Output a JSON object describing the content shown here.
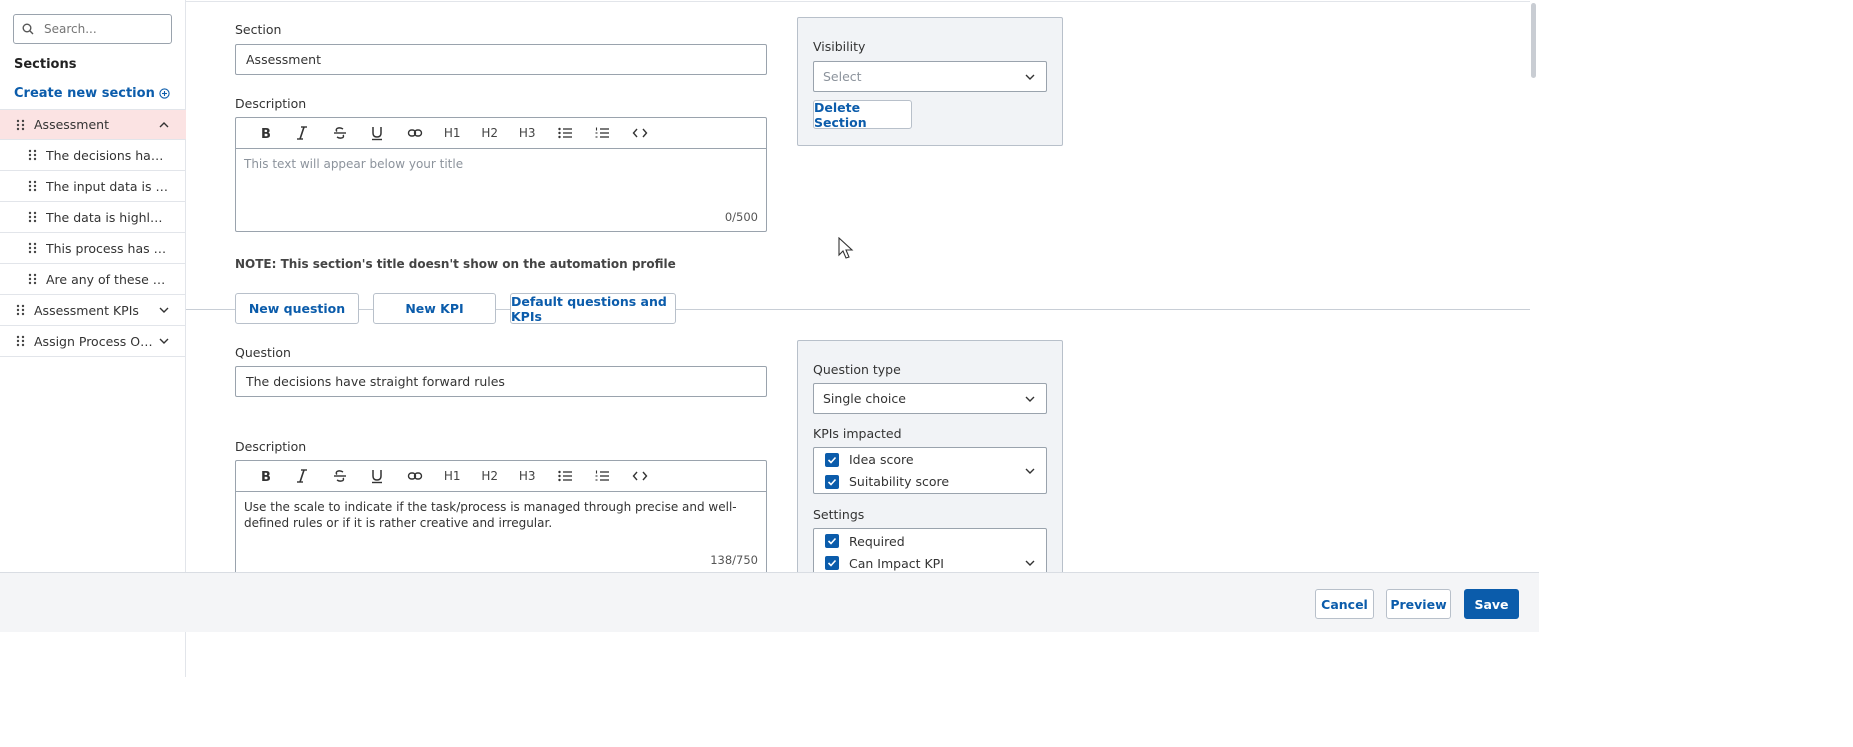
{
  "sidebar": {
    "search_placeholder": "Search...",
    "heading": "Sections",
    "create_label": "Create new section",
    "items": [
      {
        "label": "Assessment",
        "level": "top",
        "active": true,
        "expanded": true
      },
      {
        "label": "The decisions have straight forward rules",
        "level": "child"
      },
      {
        "label": "The input data is accessible",
        "level": "child"
      },
      {
        "label": "The data is highly formatted",
        "level": "child"
      },
      {
        "label": "This process has no expected changes",
        "level": "child"
      },
      {
        "label": "Are any of these processes",
        "level": "child"
      },
      {
        "label": "Assessment KPIs",
        "level": "top",
        "expanded": false
      },
      {
        "label": "Assign Process Owner",
        "level": "top",
        "expanded": false
      }
    ]
  },
  "section": {
    "label": "Section",
    "value": "Assessment",
    "description_label": "Description",
    "description_placeholder": "This text will appear below your title",
    "counter": "0/500",
    "note": "NOTE: This section's title doesn't show on the automation profile"
  },
  "toolbar": {
    "h1": "H1",
    "h2": "H2",
    "h3": "H3"
  },
  "visibility_panel": {
    "label": "Visibility",
    "select_placeholder": "Select",
    "delete_label": "Delete Section"
  },
  "actions": {
    "new_question": "New question",
    "new_kpi": "New KPI",
    "defaults": "Default questions and KPIs"
  },
  "question": {
    "label": "Question",
    "value": "The decisions have straight forward rules",
    "description_label": "Description",
    "description_text": "Use the scale to indicate if the task/process is managed through precise and well-defined rules or if it is rather creative and irregular.",
    "counter": "138/750"
  },
  "question_panel": {
    "type_label": "Question type",
    "type_value": "Single choice",
    "kpis_label": "KPIs impacted",
    "kpis": [
      "Idea score",
      "Suitability score"
    ],
    "settings_label": "Settings",
    "settings": [
      "Required",
      "Can Impact KPI"
    ]
  },
  "footer": {
    "cancel": "Cancel",
    "preview": "Preview",
    "save": "Save"
  },
  "colors": {
    "accent": "#0b5cab",
    "active_row": "#fbe3e3",
    "panel_bg": "#f1f3f6"
  }
}
